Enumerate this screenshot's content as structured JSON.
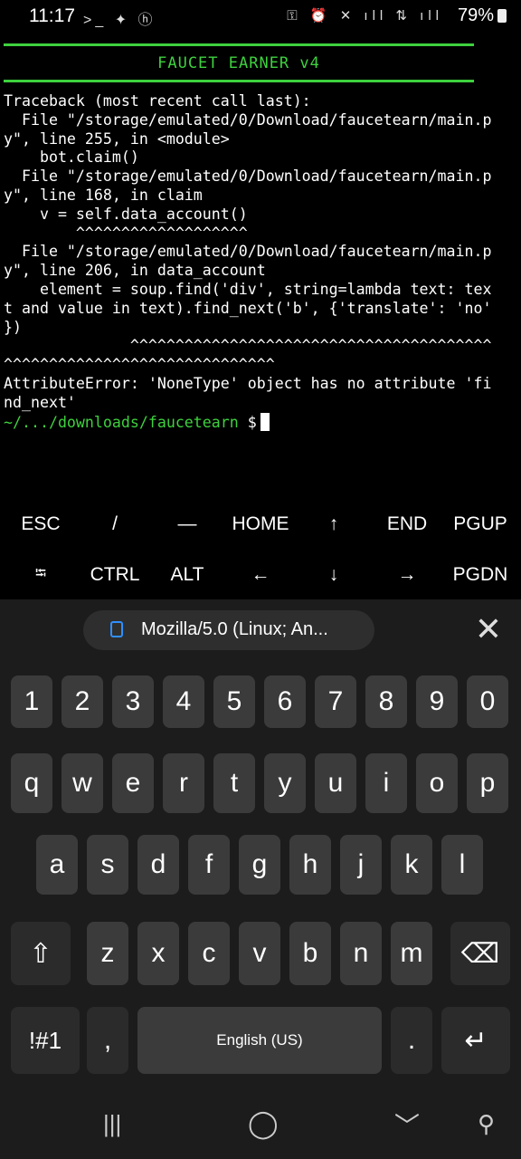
{
  "status_bar": {
    "time": "11:17",
    "left_icons": ">_ ✦ ⓗ",
    "right_icons": "⚿ ⏰ ✕ ıll ⇅ ıll",
    "battery": "79%"
  },
  "terminal": {
    "banner": "FAUCET EARNER v4",
    "traceback_lines": [
      "Traceback (most recent call last):",
      "  File \"/storage/emulated/0/Download/faucetearn/main.p",
      "y\", line 255, in <module>",
      "    bot.claim()",
      "  File \"/storage/emulated/0/Download/faucetearn/main.p",
      "y\", line 168, in claim",
      "    v = self.data_account()",
      "        ^^^^^^^^^^^^^^^^^^^",
      "  File \"/storage/emulated/0/Download/faucetearn/main.p",
      "y\", line 206, in data_account",
      "    element = soup.find('div', string=lambda text: tex",
      "t and value in text).find_next('b', {'translate': 'no'",
      "})",
      "              ^^^^^^^^^^^^^^^^^^^^^^^^^^^^^^^^^^^^^^^^",
      "^^^^^^^^^^^^^^^^^^^^^^^^^^^^^^",
      "AttributeError: 'NoneType' object has no attribute 'fi",
      "nd_next'"
    ],
    "prompt_path": "~/.../downloads/faucetearn",
    "prompt_symbol": " $"
  },
  "extra_keys": {
    "row1": [
      "ESC",
      "/",
      "—",
      "HOME",
      "↑",
      "END",
      "PGUP"
    ],
    "row2": [
      "⭾",
      "CTRL",
      "ALT",
      "←",
      "↓",
      "→",
      "PGDN"
    ]
  },
  "keyboard": {
    "suggestion": "Mozilla/5.0 (Linux; An...",
    "close": "✕",
    "numbers": [
      "1",
      "2",
      "3",
      "4",
      "5",
      "6",
      "7",
      "8",
      "9",
      "0"
    ],
    "row_q": [
      "q",
      "w",
      "e",
      "r",
      "t",
      "y",
      "u",
      "i",
      "o",
      "p"
    ],
    "row_a": [
      "a",
      "s",
      "d",
      "f",
      "g",
      "h",
      "j",
      "k",
      "l"
    ],
    "row_z": [
      "z",
      "x",
      "c",
      "v",
      "b",
      "n",
      "m"
    ],
    "shift": "⇧",
    "backspace": "⌫",
    "symbols": "!#1",
    "comma": ",",
    "space": "English (US)",
    "period": ".",
    "enter": "↵"
  },
  "nav_bar": {
    "recents": "|||",
    "home": "◯",
    "back": "﹀",
    "accessibility": "⚲"
  }
}
